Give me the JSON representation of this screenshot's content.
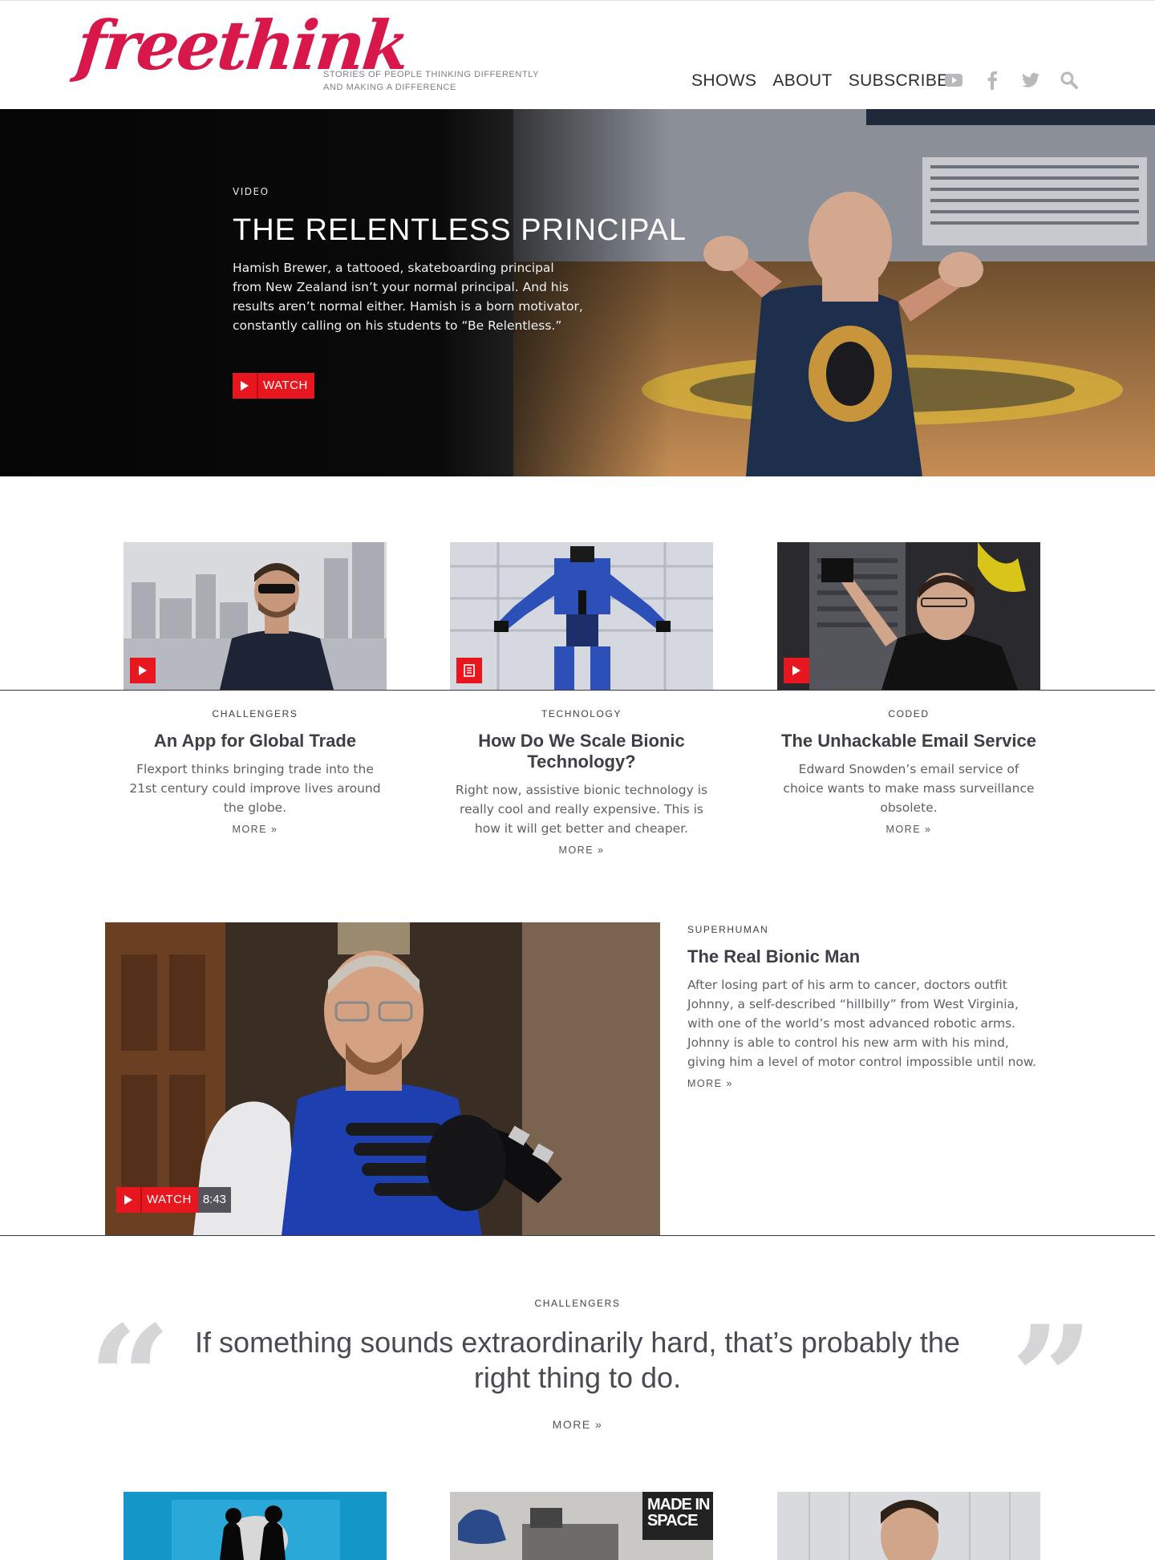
{
  "header": {
    "logo": "freethink",
    "tagline_line1": "STORIES OF PEOPLE THINKING DIFFERENTLY",
    "tagline_line2": "AND MAKING A DIFFERENCE",
    "nav": [
      "SHOWS",
      "ABOUT",
      "SUBSCRIBE"
    ],
    "social_icons": [
      "youtube-icon",
      "facebook-icon",
      "twitter-icon",
      "search-icon"
    ]
  },
  "hero": {
    "label": "VIDEO",
    "title": "THE RELENTLESS PRINCIPAL",
    "description": "Hamish Brewer, a tattooed, skateboarding principal from New Zealand isn’t your normal principal. And his results aren’t normal either. Hamish is a born motivator, constantly calling on his students to “Be Relentless.”",
    "watch_label": "WATCH"
  },
  "cards": [
    {
      "category": "CHALLENGERS",
      "title": "An App for Global Trade",
      "description": "Flexport thinks bringing trade into the 21st century could improve lives around the globe.",
      "more": "MORE »",
      "badge": "play-icon"
    },
    {
      "category": "TECHNOLOGY",
      "title": "How Do We Scale Bionic Technology?",
      "description": "Right now, assistive bionic technology is really cool and really expensive. This is how it will get better and cheaper.",
      "more": "MORE »",
      "badge": "article-icon"
    },
    {
      "category": "CODED",
      "title": "The Unhackable Email Service",
      "description": "Edward Snowden’s email service of choice wants to make mass surveillance obsolete.",
      "more": "MORE »",
      "badge": "play-icon"
    }
  ],
  "feature": {
    "category": "SUPERHUMAN",
    "title": "The Real Bionic Man",
    "description": "After losing part of his arm to cancer, doctors outfit Johnny, a self-described “hillbilly” from West Virginia, with one of the world’s most advanced robotic arms. Johnny is able to control his new arm with his mind, giving him a level of motor control impossible until now.",
    "more": "MORE »",
    "watch_label": "WATCH",
    "duration": "8:43"
  },
  "quote": {
    "category": "CHALLENGERS",
    "text": "If something sounds extraordinarily hard, that’s probably the right thing to do.",
    "more": "MORE »"
  },
  "bottom_cards": [
    {
      "image": "silhouettes-blue"
    },
    {
      "image": "made-in-space",
      "overlay_text": "MADE IN SPACE"
    },
    {
      "image": "portrait"
    }
  ],
  "colors": {
    "brand": "#d8174a",
    "accent_red": "#e8171f",
    "text_dark": "#3e3e48",
    "text_muted": "#5f5f68"
  }
}
